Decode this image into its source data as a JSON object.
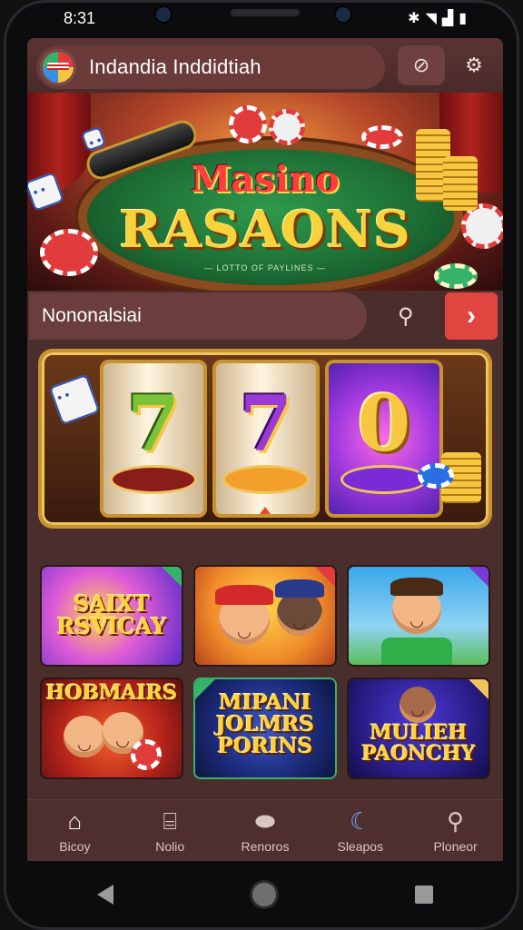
{
  "status": {
    "time": "8:31",
    "icons": [
      "bluetooth-icon",
      "wifi-icon",
      "signal-icon",
      "battery-icon"
    ]
  },
  "header": {
    "title": "Indandia Inddidtiah",
    "buttons": [
      "zoom-icon",
      "settings-icon"
    ]
  },
  "hero": {
    "line1": "Masino",
    "line2": "RASAONS",
    "small_text": "— LOTTO OF PAYLINES —"
  },
  "search": {
    "text": "Nononalsiai",
    "go_symbol": "›"
  },
  "slot": {
    "reels": [
      "7",
      "7",
      "0"
    ]
  },
  "games": [
    {
      "title": "SAIXT RSVICAY"
    },
    {
      "title": ""
    },
    {
      "title": ""
    },
    {
      "title": "HOBMAIRS"
    },
    {
      "title": "MIPANI JOLMRS PORINS"
    },
    {
      "title": "MULIEH PAONCHY"
    }
  ],
  "bottom_nav": [
    {
      "label": "Bicoy",
      "icon": "home-icon"
    },
    {
      "label": "Nolio",
      "icon": "store-icon"
    },
    {
      "label": "Renoros",
      "icon": "ticket-icon"
    },
    {
      "label": "Sleapos",
      "icon": "sleep-icon"
    },
    {
      "label": "Ploneor",
      "icon": "search-icon"
    }
  ]
}
